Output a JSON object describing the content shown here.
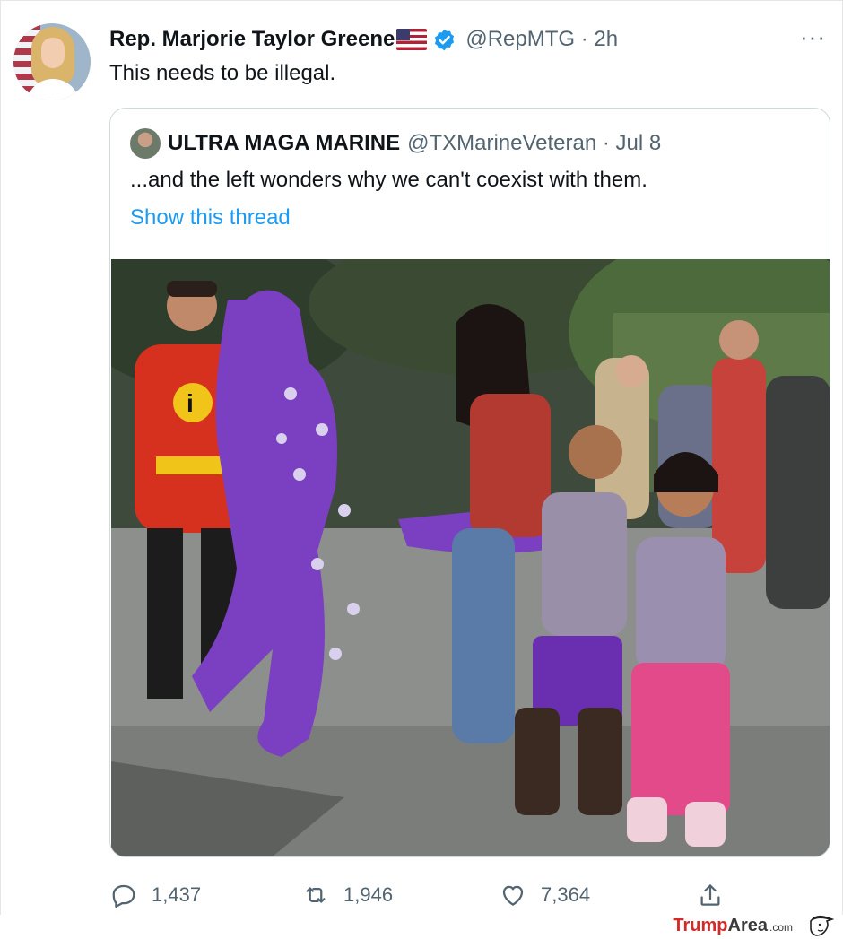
{
  "tweet": {
    "author_name": "Rep. Marjorie Taylor Greene",
    "author_handle": "@RepMTG · 2h",
    "text": "This needs to be illegal.",
    "more_label": "···"
  },
  "quote": {
    "author_name": "ULTRA MAGA MARINE",
    "author_handle": "@TXMarineVeteran · Jul 8",
    "text": "...and the left wonders why we can't coexist with them.",
    "link": "Show this thread"
  },
  "photo": {
    "description_icon": "photo"
  },
  "actions": {
    "reply_count": "1,437",
    "retweet_count": "1,946",
    "like_count": "7,364"
  },
  "watermark": {
    "brand_red": "Trump",
    "brand_dark": "Area",
    "suffix": ".com"
  },
  "colors": {
    "link": "#1d9bf0",
    "secondary_text": "#536471",
    "verified": "#1d9bf0",
    "border": "#cfd9de",
    "watermark_red": "#d32a2a"
  }
}
